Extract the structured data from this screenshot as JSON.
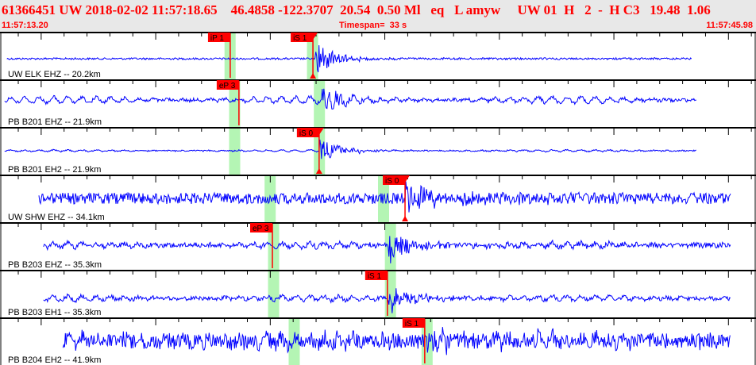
{
  "header": {
    "title": "61366451 UW 2018-02-02 11:57:18.65    46.4858 -122.3707  20.54  0.50 Ml   eq   L amyw     UW 01  H   2  -  H C3   19.48  1.06",
    "start_time": "11:57:13.20",
    "timespan": "Timespan=  33 s",
    "end_time": "11:57:45.98"
  },
  "timespan_s": 33,
  "colors": {
    "trace": "#0000ff",
    "pick": "#ff0000",
    "window": "#b4f5b4",
    "header_bg": "#e8e8e8"
  },
  "channels": [
    {
      "label": "UW ELK EHZ -- 20.2km",
      "start_s": 0.3,
      "end_s": 30.2,
      "noise": 1.2,
      "wave": 0,
      "burst_s": 13.75,
      "burst_amp": 22,
      "windows_s": [
        9.8,
        13.4
      ],
      "picks": [
        {
          "label": "iP 1",
          "time_s": 10.05,
          "flag": false
        },
        {
          "label": "iS 1",
          "time_s": 13.66,
          "flag": true
        }
      ]
    },
    {
      "label": "PB B201 EHZ -- 21.9km",
      "start_s": 0.2,
      "end_s": 30.4,
      "noise": 2,
      "wave": 4,
      "burst_s": 14.0,
      "burst_amp": 22,
      "windows_s": [
        10.0,
        13.7
      ],
      "picks": [
        {
          "label": "eP 3",
          "time_s": 10.43,
          "flag": false
        }
      ]
    },
    {
      "label": "PB B201 EH2 -- 21.9km",
      "start_s": 0.2,
      "end_s": 30.4,
      "noise": 0.8,
      "wave": 1,
      "burst_s": 13.95,
      "burst_amp": 16,
      "windows_s": [
        10.0,
        13.7
      ],
      "picks": [
        {
          "label": "iS 0",
          "time_s": 13.93,
          "flag": true
        }
      ]
    },
    {
      "label": "UW SHW EHZ -- 34.1km",
      "start_s": 1.7,
      "end_s": 31.9,
      "noise": 7,
      "wave": 0,
      "burst_s": 17.7,
      "burst_amp": 20,
      "windows_s": [
        11.55,
        16.5
      ],
      "picks": [
        {
          "label": "iS 0",
          "time_s": 17.68,
          "flag": true
        }
      ]
    },
    {
      "label": "PB B203 EHZ -- 35.3km",
      "start_s": 1.9,
      "end_s": 31.9,
      "noise": 3,
      "wave": 3,
      "burst_s": 16.95,
      "burst_amp": 24,
      "windows_s": [
        11.7,
        16.8
      ],
      "picks": [
        {
          "label": "eP 3",
          "time_s": 11.89,
          "flag": false
        }
      ]
    },
    {
      "label": "PB B203 EH1 -- 35.3km",
      "start_s": 1.9,
      "end_s": 31.9,
      "noise": 2.5,
      "wave": 3,
      "burst_s": 16.95,
      "burst_amp": 22,
      "windows_s": [
        11.7,
        16.8
      ],
      "picks": [
        {
          "label": "iS 1",
          "time_s": 16.91,
          "flag": false
        }
      ]
    },
    {
      "label": "PB B204 EH2 -- 41.9km",
      "start_s": 2.75,
      "end_s": 31.9,
      "noise": 10,
      "wave": 5,
      "burst_s": 18.6,
      "burst_amp": 22,
      "windows_s": [
        12.6,
        18.4
      ],
      "picks": [
        {
          "label": "iS 1",
          "time_s": 18.54,
          "flag": false
        }
      ]
    }
  ]
}
